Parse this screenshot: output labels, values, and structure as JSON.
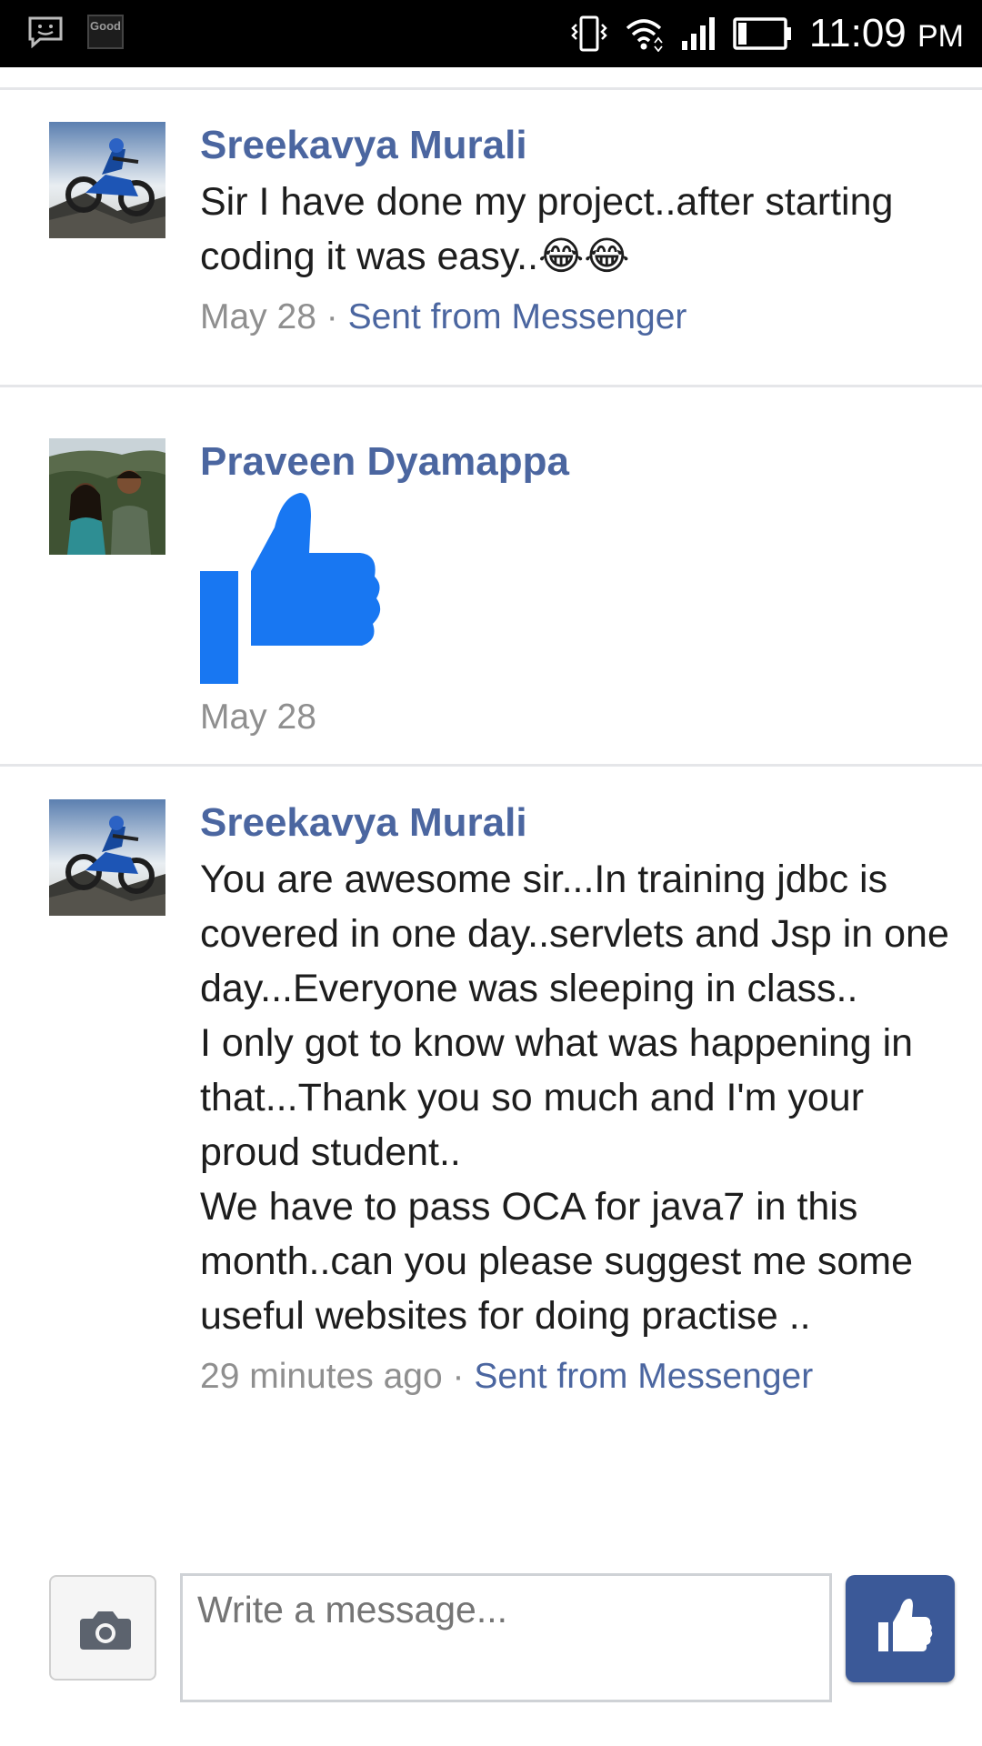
{
  "status_bar": {
    "left_icons": [
      "messenger-notification-icon",
      "good-app-icon"
    ],
    "good_label": "Good",
    "right_icons": [
      "vibrate-icon",
      "wifi-icon",
      "signal-icon",
      "battery-icon"
    ],
    "time": "11:09",
    "ampm": "PM"
  },
  "messages": [
    {
      "sender": "Sreekavya Murali",
      "text": "Sir I have done my project..after starting coding it was easy..😂😂",
      "date": "May 28",
      "separator": " · ",
      "source": "Sent from Messenger"
    },
    {
      "sender": "Praveen Dyamappa",
      "sticker": "thumbs-up",
      "sticker_color": "#1877f2",
      "date": "May 28"
    },
    {
      "sender": "Sreekavya Murali",
      "text": "You are awesome sir...In training jdbc is covered in one day..servlets and Jsp in one day...Everyone was sleeping in class..\nI only got to know what was happening in that...Thank you so much and I'm your proud student..\nWe have to pass OCA for java7 in this month..can you please suggest me some useful websites for doing practise ..",
      "date": "29 minutes ago",
      "separator": " · ",
      "source": "Sent from Messenger"
    }
  ],
  "composer": {
    "placeholder": "Write a message...",
    "camera_icon": "camera-icon",
    "like_icon": "thumbs-up-icon",
    "like_color": "#3b5998"
  }
}
